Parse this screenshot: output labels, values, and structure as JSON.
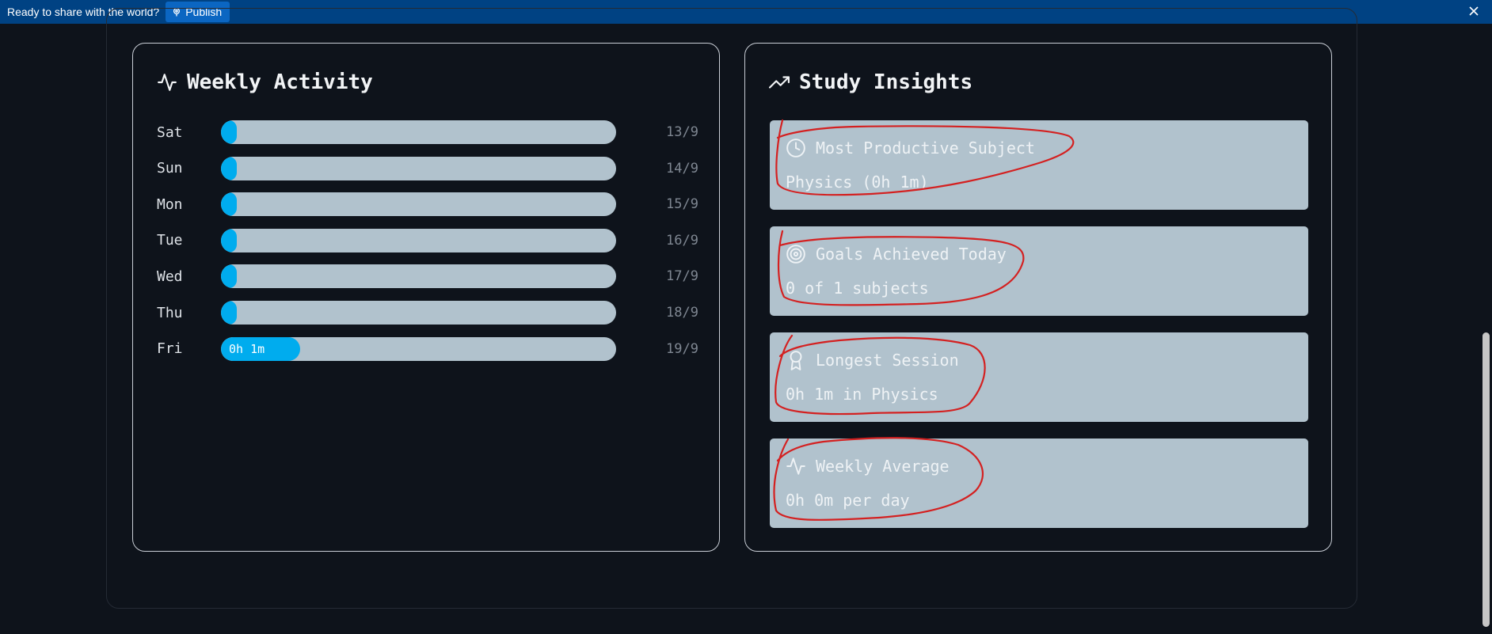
{
  "banner": {
    "text": "Ready to share with the world?",
    "publish_label": "Publish"
  },
  "weekly_activity": {
    "title": "Weekly Activity",
    "rows": [
      {
        "day": "Sat",
        "date": "13/9",
        "bar_label": "",
        "fill_fraction": 0.04
      },
      {
        "day": "Sun",
        "date": "14/9",
        "bar_label": "",
        "fill_fraction": 0.04
      },
      {
        "day": "Mon",
        "date": "15/9",
        "bar_label": "",
        "fill_fraction": 0.04
      },
      {
        "day": "Tue",
        "date": "16/9",
        "bar_label": "",
        "fill_fraction": 0.04
      },
      {
        "day": "Wed",
        "date": "17/9",
        "bar_label": "",
        "fill_fraction": 0.04
      },
      {
        "day": "Thu",
        "date": "18/9",
        "bar_label": "",
        "fill_fraction": 0.04
      },
      {
        "day": "Fri",
        "date": "19/9",
        "bar_label": "0h 1m",
        "fill_fraction": 0.2
      }
    ]
  },
  "study_insights": {
    "title": "Study Insights",
    "items": [
      {
        "icon": "clock-icon",
        "title": "Most Productive Subject",
        "value": "Physics (0h 1m)"
      },
      {
        "icon": "target-icon",
        "title": "Goals Achieved Today",
        "value": "0 of 1 subjects"
      },
      {
        "icon": "award-icon",
        "title": "Longest Session",
        "value": "0h 1m in Physics"
      },
      {
        "icon": "activity-icon",
        "title": "Weekly Average",
        "value": "0h 0m per day"
      }
    ]
  },
  "colors": {
    "background": "#0e131b",
    "banner": "#004283",
    "bar_track": "#b1c2cd",
    "bar_fill": "#00acee",
    "annotation": "#d42020"
  }
}
